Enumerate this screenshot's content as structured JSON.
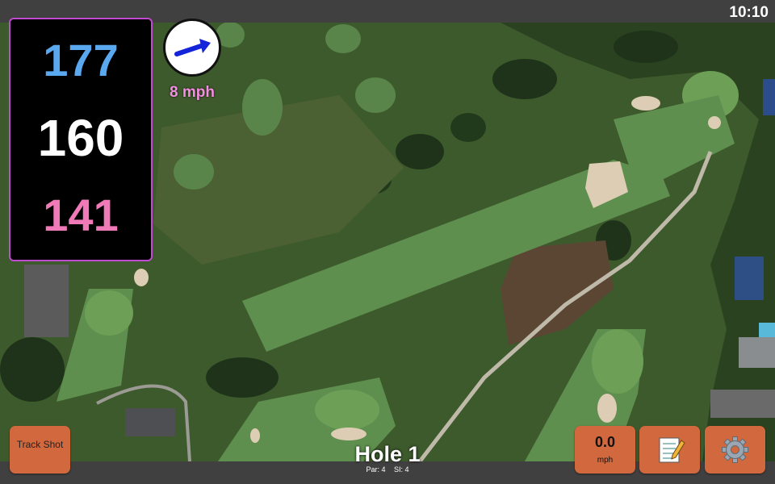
{
  "status_bar": {
    "time": "10:10"
  },
  "distances": {
    "back": "177",
    "middle": "160",
    "front": "141"
  },
  "wind": {
    "speed_label": "8 mph",
    "direction_icon": "arrow-icon"
  },
  "hole": {
    "title": "Hole 1",
    "par": "Par: 4",
    "stroke_index": "SI: 4"
  },
  "buttons": {
    "track_shot": "Track Shot",
    "speed_value": "0.0",
    "speed_unit": "mph",
    "notes_icon": "notepad-icon",
    "settings_icon": "gear-icon"
  },
  "colors": {
    "back_distance": "#5aa8f0",
    "middle_distance": "#ffffff",
    "front_distance": "#f07ab8",
    "panel_border": "#c04ad0",
    "button_bg": "#d1683e",
    "wind_label": "#f48ee0"
  }
}
